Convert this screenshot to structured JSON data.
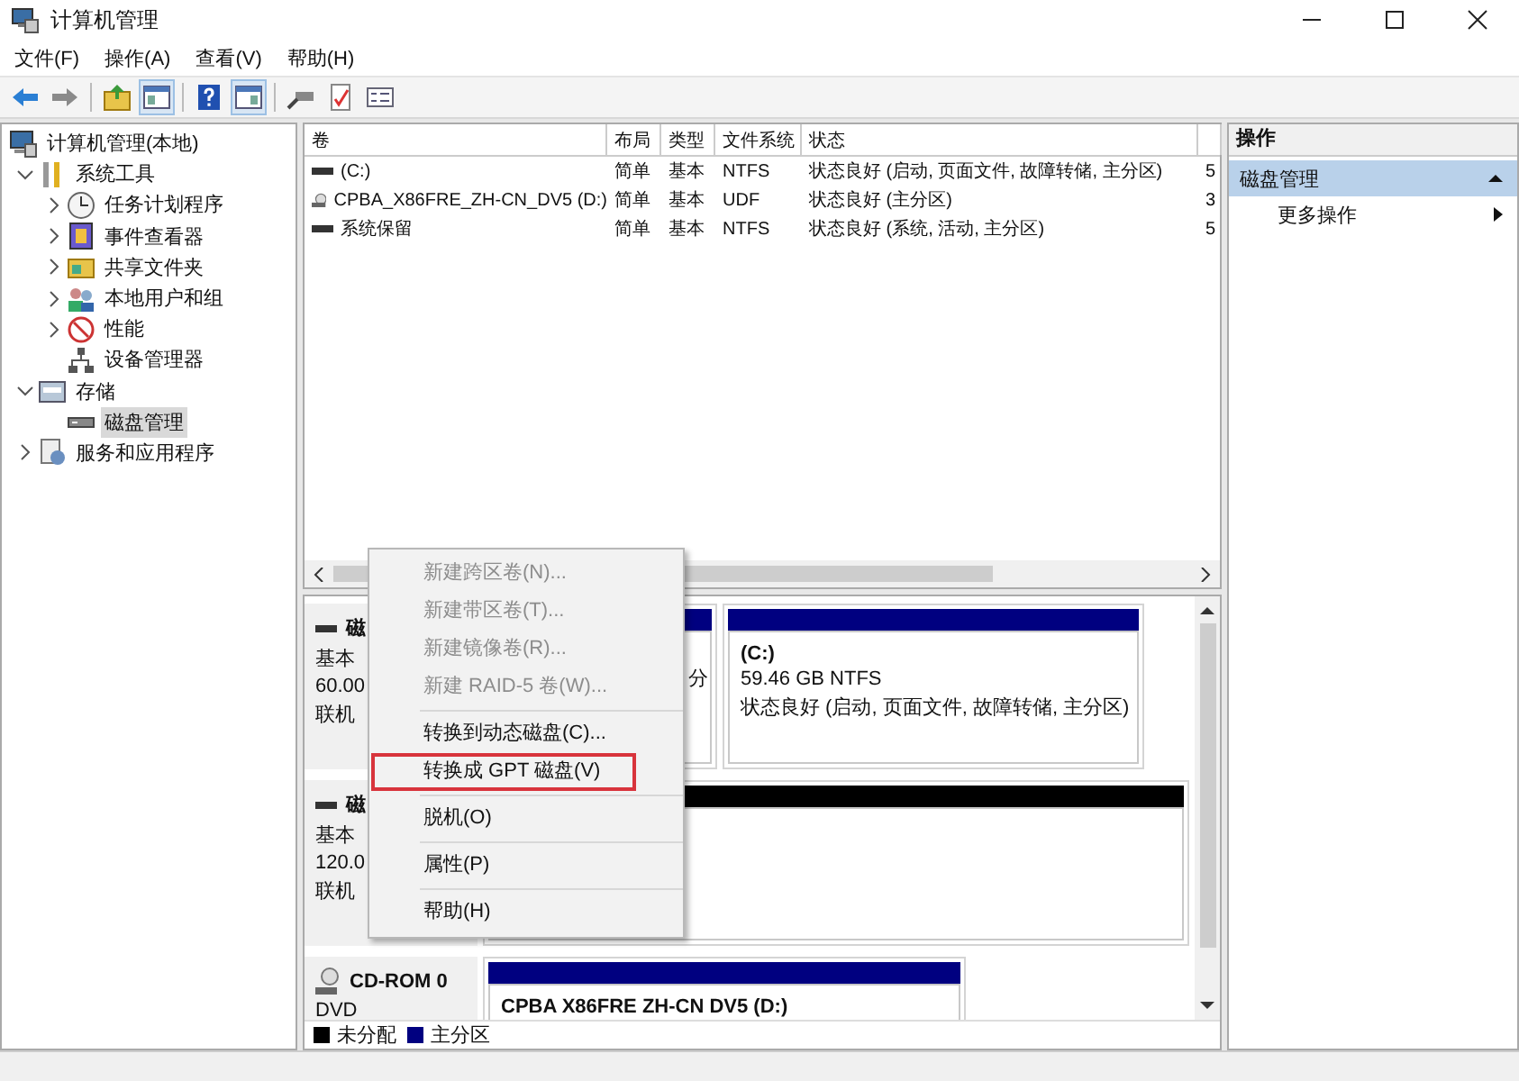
{
  "window": {
    "title": "计算机管理"
  },
  "menu": [
    "文件(F)",
    "操作(A)",
    "查看(V)",
    "帮助(H)"
  ],
  "toolbar": [
    {
      "kind": "back",
      "disabled": false,
      "pressed": false
    },
    {
      "kind": "forward",
      "disabled": true,
      "pressed": false
    },
    {
      "kind": "separator"
    },
    {
      "kind": "up",
      "pressed": false
    },
    {
      "kind": "tree",
      "pressed": true
    },
    {
      "kind": "separator"
    },
    {
      "kind": "help",
      "pressed": false
    },
    {
      "kind": "pane",
      "pressed": true
    },
    {
      "kind": "separator"
    },
    {
      "kind": "connect",
      "pressed": false
    },
    {
      "kind": "check",
      "pressed": false
    },
    {
      "kind": "list",
      "pressed": false
    }
  ],
  "tree": [
    {
      "label": "计算机管理(本地)",
      "kind": "computer",
      "expandable": false,
      "selected": false,
      "children": [
        {
          "label": "系统工具",
          "kind": "tools",
          "expandable": true,
          "expanded": true,
          "selected": false,
          "children": [
            {
              "label": "任务计划程序",
              "kind": "clock",
              "expandable": true,
              "expanded": false,
              "selected": false
            },
            {
              "label": "事件查看器",
              "kind": "event",
              "expandable": true,
              "expanded": false,
              "selected": false
            },
            {
              "label": "共享文件夹",
              "kind": "share",
              "expandable": true,
              "expanded": false,
              "selected": false
            },
            {
              "label": "本地用户和组",
              "kind": "users",
              "expandable": true,
              "expanded": false,
              "selected": false
            },
            {
              "label": "性能",
              "kind": "perf",
              "expandable": true,
              "expanded": false,
              "selected": false
            },
            {
              "label": "设备管理器",
              "kind": "device",
              "expandable": false,
              "selected": false
            }
          ]
        },
        {
          "label": "存储",
          "kind": "storage",
          "expandable": true,
          "expanded": true,
          "selected": false,
          "children": [
            {
              "label": "磁盘管理",
              "kind": "disk",
              "expandable": false,
              "selected": true
            }
          ]
        },
        {
          "label": "服务和应用程序",
          "kind": "services",
          "expandable": true,
          "expanded": false,
          "selected": false
        }
      ]
    }
  ],
  "table": {
    "columns": [
      "卷",
      "布局",
      "类型",
      "文件系统",
      "状态",
      ""
    ],
    "rows": [
      {
        "kind": "disk",
        "cells": [
          "(C:)",
          "简单",
          "基本",
          "NTFS",
          "状态良好 (启动, 页面文件, 故障转储, 主分区)",
          "5"
        ]
      },
      {
        "kind": "cdrom",
        "cells": [
          "CPBA_X86FRE_ZH-CN_DV5 (D:)",
          "简单",
          "基本",
          "UDF",
          "状态良好 (主分区)",
          "3"
        ]
      },
      {
        "kind": "disk",
        "cells": [
          "系统保留",
          "简单",
          "基本",
          "NTFS",
          "状态良好 (系统, 活动, 主分区)",
          "5"
        ]
      }
    ]
  },
  "disks": [
    {
      "kind": "disk",
      "name": "磁",
      "type": "基本",
      "size": "60.00",
      "state": "联机",
      "partitions": [
        {
          "kind": "primary",
          "lines": [
            "分"
          ]
        },
        {
          "kind": "primary",
          "title": "(C:)",
          "lines": [
            "59.46 GB NTFS",
            "状态良好 (启动, 页面文件, 故障转储, 主分区)"
          ]
        }
      ]
    },
    {
      "kind": "disk",
      "name": "磁",
      "type": "基本",
      "size": "120.0",
      "state": "联机",
      "partitions": [
        {
          "kind": "unallocated"
        }
      ]
    },
    {
      "kind": "cdrom",
      "name": "CD-ROM 0",
      "type": "DVD",
      "partitions": [
        {
          "kind": "primary",
          "title": "CPBA X86FRE ZH-CN DV5  (D:)"
        }
      ]
    }
  ],
  "legend": [
    {
      "label": "未分配",
      "color": "#000000"
    },
    {
      "label": "主分区",
      "color": "#000080"
    }
  ],
  "context_menu": [
    [
      {
        "label": "新建跨区卷(N)...",
        "disabled": true,
        "selected": false
      },
      {
        "label": "新建带区卷(T)...",
        "disabled": true,
        "selected": false
      },
      {
        "label": "新建镜像卷(R)...",
        "disabled": true,
        "selected": false
      },
      {
        "label": "新建 RAID-5 卷(W)...",
        "disabled": true,
        "selected": false
      }
    ],
    [
      {
        "label": "转换到动态磁盘(C)...",
        "disabled": false,
        "selected": false
      },
      {
        "label": "转换成 GPT 磁盘(V)",
        "disabled": false,
        "selected": true
      }
    ],
    [
      {
        "label": "脱机(O)",
        "disabled": false,
        "selected": false
      }
    ],
    [
      {
        "label": "属性(P)",
        "disabled": false,
        "selected": false
      }
    ],
    [
      {
        "label": "帮助(H)",
        "disabled": false,
        "selected": false
      }
    ]
  ],
  "actions": {
    "title": "操作",
    "sections": [
      {
        "label": "磁盘管理",
        "expanded": true,
        "items": [
          "更多操作"
        ]
      }
    ]
  }
}
